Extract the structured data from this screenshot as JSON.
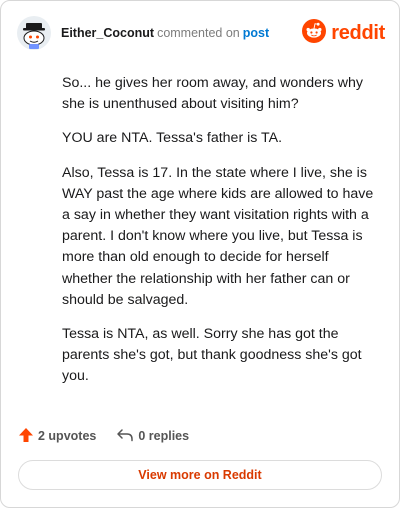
{
  "header": {
    "username": "Either_Coconut",
    "action_text": "commented on",
    "post_link_text": "post",
    "brand": "reddit"
  },
  "comment": {
    "paragraphs": [
      "So... he gives her room away, and wonders why she is unenthused about visiting him?",
      "YOU are NTA. Tessa's father is TA.",
      "Also, Tessa is 17. In the state where I live, she is WAY past the age where kids are allowed to have a say in whether they want visitation rights with a parent. I don't know where you live, but Tessa is more than old enough to decide for herself whether the relationship with her father can or should be salvaged.",
      "Tessa is NTA, as well. Sorry she has got the parents she's got, but thank goodness she's got you."
    ]
  },
  "actions": {
    "upvotes": "2 upvotes",
    "replies": "0 replies"
  },
  "footer": {
    "view_more": "View more on Reddit"
  },
  "colors": {
    "brand": "#ff4500",
    "link": "#0079d3",
    "upvote": "#ff4500",
    "view_more": "#d93a00"
  },
  "icons": {
    "avatar": "snoo-avatar-icon",
    "logo": "reddit-snoo-icon",
    "upvote": "upvote-arrow-icon",
    "reply": "reply-arrow-icon"
  }
}
